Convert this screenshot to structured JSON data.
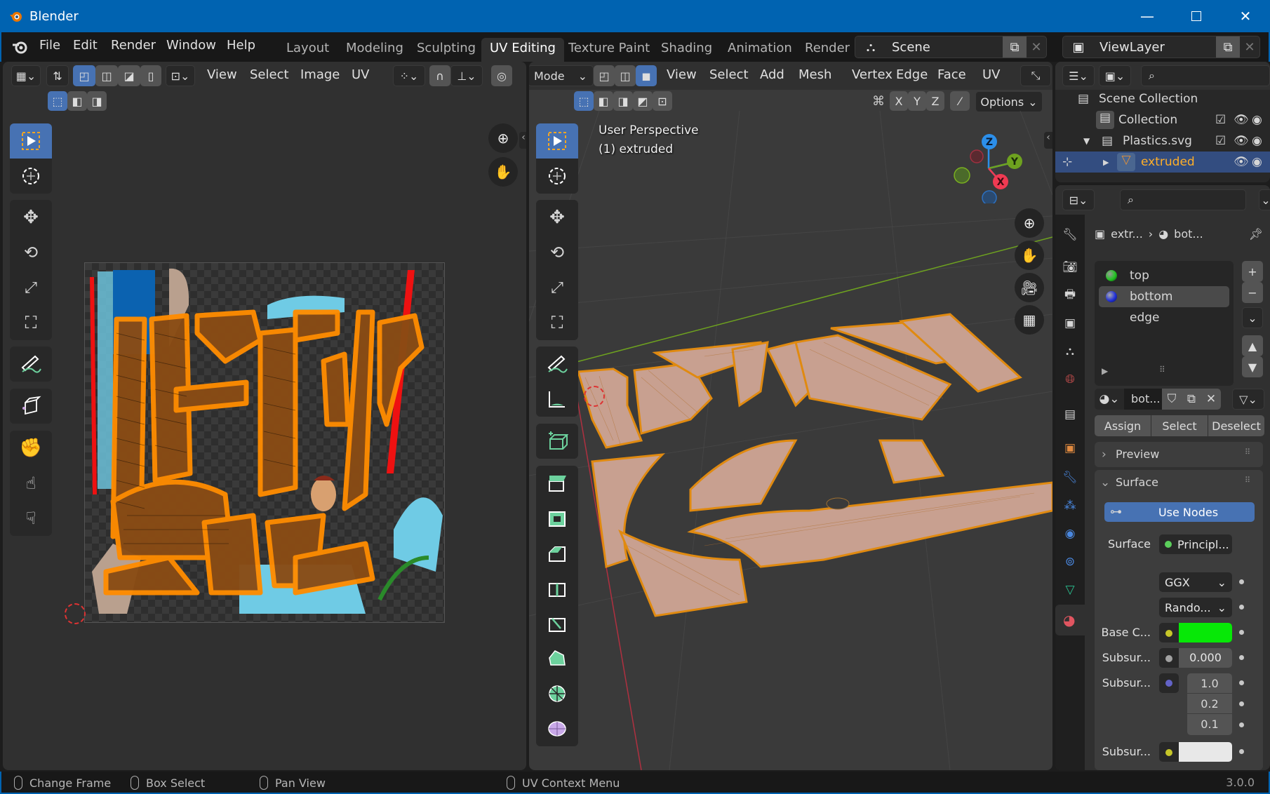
{
  "window": {
    "title": "Blender",
    "controls": [
      "minimize",
      "maximize",
      "close"
    ]
  },
  "menu": [
    "File",
    "Edit",
    "Render",
    "Window",
    "Help"
  ],
  "workspaces": [
    "Layout",
    "Modeling",
    "Sculpting",
    "UV Editing",
    "Texture Paint",
    "Shading",
    "Animation",
    "Render"
  ],
  "active_workspace": "UV Editing",
  "scene": {
    "name": "Scene"
  },
  "view_layer": {
    "name": "ViewLayer"
  },
  "uv_editor": {
    "menus": [
      "View",
      "Select",
      "Image",
      "UV"
    ],
    "tools": [
      "select-box",
      "cursor",
      "move",
      "rotate",
      "scale",
      "transform",
      "annotate",
      "rip-region",
      "grab",
      "relax",
      "pinch"
    ]
  },
  "viewport": {
    "mode": "Edit Mode",
    "mode_display": "Mode",
    "menus": [
      "View",
      "Select",
      "Add",
      "Mesh",
      "Vertex",
      "Edge",
      "Face",
      "UV"
    ],
    "axes": [
      "X",
      "Y",
      "Z"
    ],
    "options_label": "Options",
    "overlay_line1": "User Perspective",
    "overlay_line2": "(1) extruded",
    "gizmo": {
      "z": "Z",
      "y": "Y",
      "x": "X",
      "colors": {
        "x": "#f03a52",
        "y": "#6ea21f",
        "z": "#2c8fea"
      }
    },
    "tools": [
      "select-box",
      "cursor",
      "move",
      "rotate",
      "scale",
      "transform",
      "annotate",
      "measure",
      "add-cube",
      "extrude-region",
      "inset-faces",
      "bevel",
      "loop-cut",
      "knife",
      "poly-build",
      "spin",
      "smooth",
      "shrink-fatten"
    ]
  },
  "outliner": {
    "root": "Scene Collection",
    "items": [
      {
        "name": "Collection",
        "level": 1,
        "checked": true
      },
      {
        "name": "Plastics.svg",
        "level": 1,
        "checked": true,
        "expanded": true
      },
      {
        "name": "extruded",
        "level": 2,
        "selected": true
      }
    ]
  },
  "properties": {
    "breadcrumb": {
      "object": "extr...",
      "material": "bot..."
    },
    "material_slots": [
      {
        "name": "top",
        "color": "#e02020"
      },
      {
        "name": "bottom",
        "color": "#22c422",
        "selected": true
      },
      {
        "name": "edge",
        "color": "#2030d8"
      }
    ],
    "material_name": "bot...",
    "buttons": {
      "assign": "Assign",
      "select": "Select",
      "deselect": "Deselect"
    },
    "panels": {
      "preview": "Preview",
      "surface": "Surface"
    },
    "use_nodes_label": "Use Nodes",
    "fields": {
      "surface_label": "Surface",
      "surface_value": "Principl...",
      "distribution": "GGX",
      "subsurface_method": "Rando...",
      "base_color_label": "Base C...",
      "base_color": "#07e807",
      "subsurface_label": "Subsur...",
      "subsurface_value": "0.000",
      "subsurface_radius_label": "Subsur...",
      "subsurface_radius": [
        "1.0",
        "0.2",
        "0.1"
      ],
      "subsurface_color_label": "Subsur...",
      "subsurface_color": "#e8e8e8"
    }
  },
  "status_bar": {
    "items": [
      "Change Frame",
      "Box Select",
      "Pan View",
      "UV Context Menu"
    ],
    "version": "3.0.0"
  }
}
